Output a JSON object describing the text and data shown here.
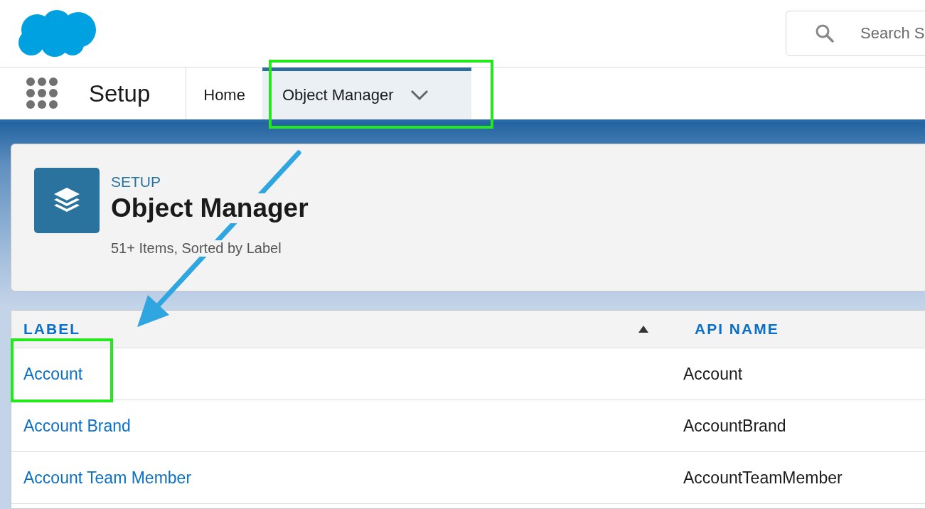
{
  "header": {
    "search": {
      "placeholder": "Search S"
    }
  },
  "nav": {
    "app_name": "Setup",
    "tabs": [
      {
        "label": "Home",
        "selected": false,
        "has_menu": false
      },
      {
        "label": "Object Manager",
        "selected": true,
        "has_menu": true
      }
    ]
  },
  "page_header": {
    "eyebrow": "SETUP",
    "title": "Object Manager",
    "meta": "51+ Items, Sorted by Label"
  },
  "table": {
    "columns": [
      {
        "label": "LABEL",
        "sorted": true
      },
      {
        "label": "API NAME",
        "sorted": false
      }
    ],
    "rows": [
      {
        "label": "Account",
        "api_name": "Account"
      },
      {
        "label": "Account Brand",
        "api_name": "AccountBrand"
      },
      {
        "label": "Account Team Member",
        "api_name": "AccountTeamMember"
      }
    ]
  }
}
